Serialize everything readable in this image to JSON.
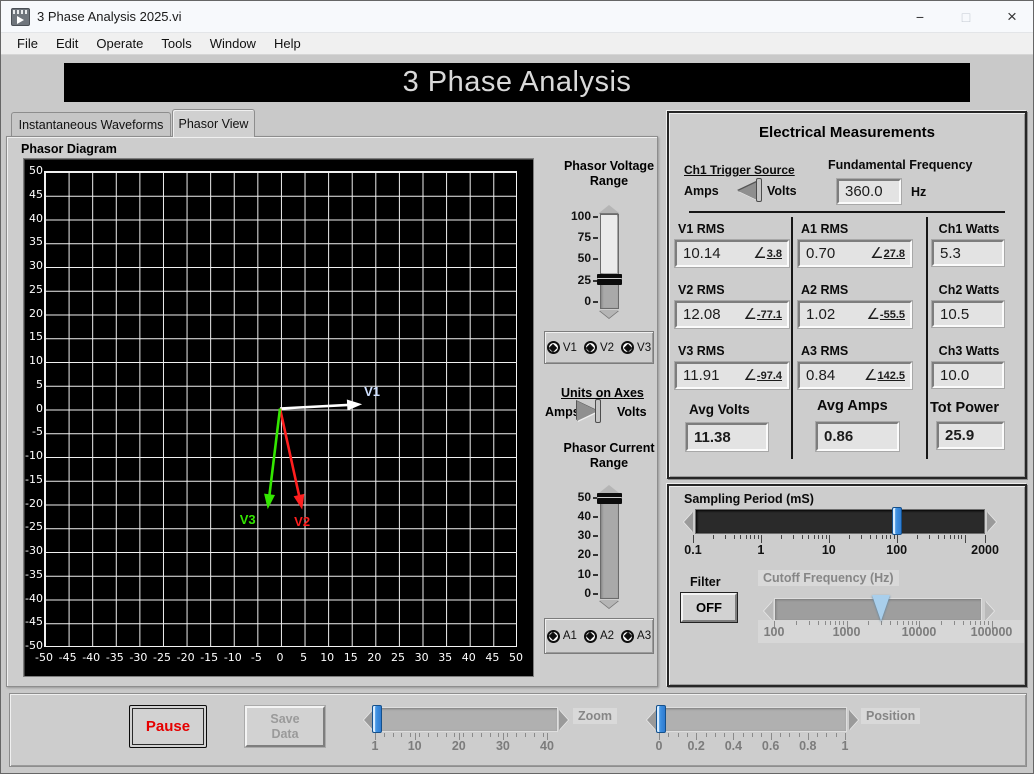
{
  "window": {
    "title": "3 Phase Analysis 2025.vi"
  },
  "icons": {
    "minimize": "−",
    "maximize": "□",
    "close": "×"
  },
  "menu": {
    "items": [
      "File",
      "Edit",
      "Operate",
      "Tools",
      "Window",
      "Help"
    ]
  },
  "banner": {
    "title": "3 Phase Analysis"
  },
  "tabs": {
    "items": [
      {
        "label": "Instantaneous Waveforms",
        "active": false
      },
      {
        "label": "Phasor View",
        "active": true
      }
    ]
  },
  "plot": {
    "label": "Phasor Diagram"
  },
  "chart_data": {
    "type": "phasor",
    "title": "Phasor Diagram",
    "xlim": [
      -50,
      50
    ],
    "ylim": [
      -50,
      50
    ],
    "tick_step": 5,
    "grid": true,
    "vectors": [
      {
        "name": "V1",
        "magnitude_rms": 10.14,
        "angle_deg": 3.8,
        "color": "#ffffff",
        "label_color": "#cfe0ff",
        "plot_end_units": [
          17.4,
          0.9
        ]
      },
      {
        "name": "V2",
        "magnitude_rms": 12.08,
        "angle_deg": -77.1,
        "color": "#ff1f1f",
        "label_color": "#ff1f1f",
        "plot_end_units": [
          4.7,
          -21.3
        ]
      },
      {
        "name": "V3",
        "magnitude_rms": 11.91,
        "angle_deg": -97.4,
        "color": "#33e600",
        "label_color": "#33e600",
        "plot_end_units": [
          -2.6,
          -21.2
        ]
      }
    ]
  },
  "voltage_range": {
    "label": "Phasor Voltage Range",
    "ticks": [
      100,
      75,
      50,
      25,
      0
    ],
    "min": 0,
    "max": 100,
    "value": 27
  },
  "voltage_channels": {
    "items": [
      "V1",
      "V2",
      "V3"
    ]
  },
  "units_toggle": {
    "label": "Units on Axes",
    "left": "Amps",
    "right": "Volts",
    "selected": "Volts"
  },
  "current_range": {
    "label": "Phasor Current Range",
    "ticks": [
      50,
      40,
      30,
      20,
      10,
      0
    ],
    "min": 0,
    "max": 50,
    "value": 50
  },
  "current_channels": {
    "items": [
      "A1",
      "A2",
      "A3"
    ]
  },
  "measurements": {
    "title": "Electrical Measurements",
    "angle_symbol": "∠",
    "trigger": {
      "label": "Ch1 Trigger Source",
      "left": "Amps",
      "right": "Volts",
      "selected": "Volts"
    },
    "freq": {
      "label": "Fundamental Frequency",
      "value": "360.0",
      "unit": "Hz"
    },
    "rms": [
      {
        "label": "V1 RMS",
        "value": "10.14",
        "angle": "3.8"
      },
      {
        "label": "V2 RMS",
        "value": "12.08",
        "angle": "-77.1"
      },
      {
        "label": "V3 RMS",
        "value": "11.91",
        "angle": "-97.4"
      },
      {
        "label": "A1 RMS",
        "value": "0.70",
        "angle": "27.8"
      },
      {
        "label": "A2 RMS",
        "value": "1.02",
        "angle": "-55.5"
      },
      {
        "label": "A3 RMS",
        "value": "0.84",
        "angle": "142.5"
      }
    ],
    "watts": [
      {
        "label": "Ch1 Watts",
        "value": "5.3"
      },
      {
        "label": "Ch2 Watts",
        "value": "10.5"
      },
      {
        "label": "Ch3 Watts",
        "value": "10.0"
      }
    ],
    "avg_volts": {
      "label": "Avg Volts",
      "value": "11.38"
    },
    "avg_amps": {
      "label": "Avg Amps",
      "value": "0.86"
    },
    "tot_power": {
      "label": "Tot Power",
      "value": "25.9"
    }
  },
  "sampling": {
    "label": "Sampling Period (mS)",
    "tick_labels": [
      "0.1",
      "1",
      "10",
      "100",
      "2000"
    ],
    "value": 100
  },
  "filter": {
    "label": "Filter",
    "state": "OFF"
  },
  "cutoff": {
    "label": "Cutoff Frequency (Hz)",
    "tick_labels": [
      "100",
      "1000",
      "10000",
      "100000"
    ],
    "value": 3000,
    "disabled": true
  },
  "controls": {
    "pause": "Pause",
    "save": "Save Data",
    "zoom": {
      "label": "Zoom",
      "tick_labels": [
        "1",
        "10",
        "20",
        "30",
        "40"
      ],
      "min": 1,
      "max": 40,
      "value": 1
    },
    "position": {
      "label": "Position",
      "tick_labels": [
        "0",
        "0.2",
        "0.4",
        "0.6",
        "0.8",
        "1"
      ],
      "min": 0,
      "max": 1,
      "value": 0
    }
  }
}
